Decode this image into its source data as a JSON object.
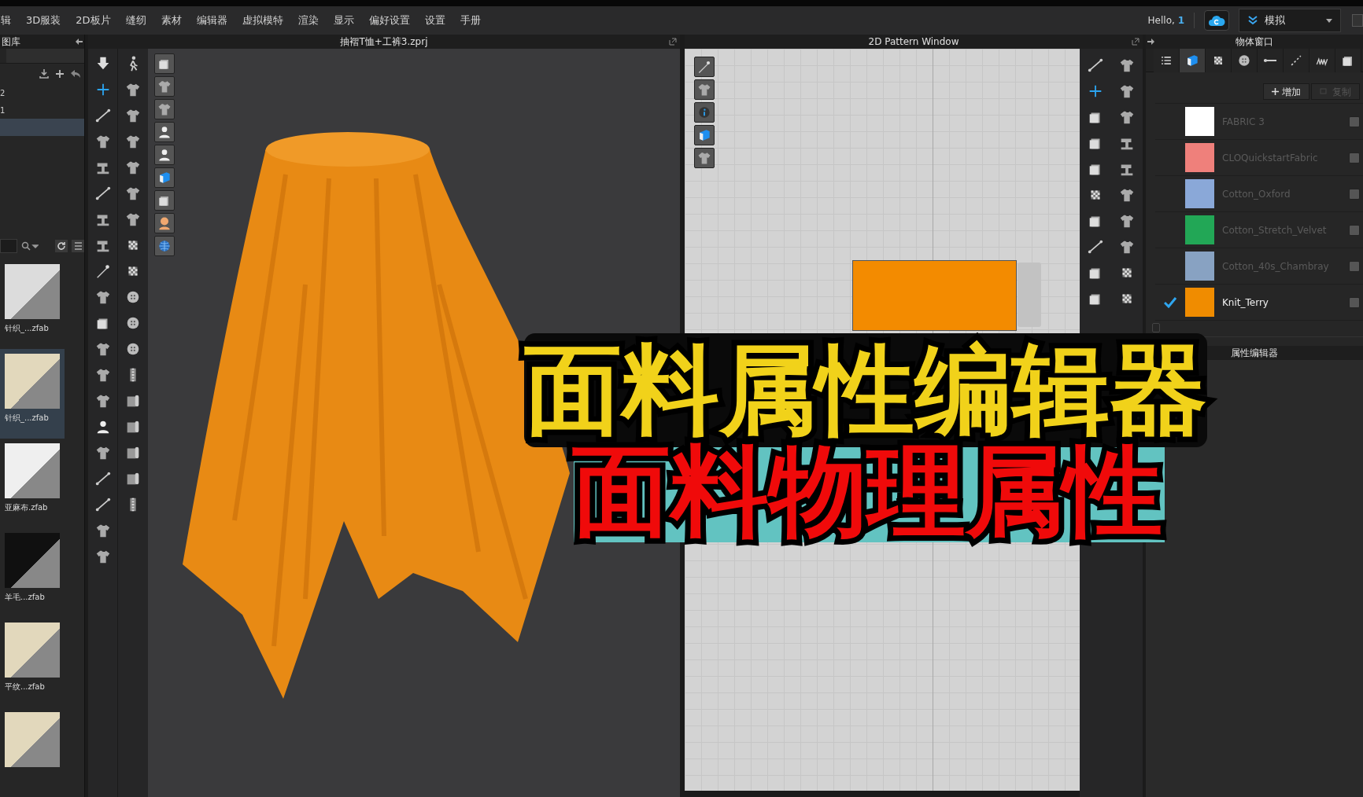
{
  "menu": [
    "辑",
    "3D服装",
    "2D板片",
    "缝纫",
    "素材",
    "编辑器",
    "虚拟模特",
    "渲染",
    "显示",
    "偏好设置",
    "设置",
    "手册"
  ],
  "user": {
    "greeting": "Hello,",
    "name": "1"
  },
  "mode": {
    "label": "模拟"
  },
  "library": {
    "title": "图库",
    "rows": [
      {
        "label": "2",
        "selected": false
      },
      {
        "label": "1",
        "selected": false
      },
      {
        "selected": true
      }
    ],
    "thumbnails": [
      {
        "label": "针织_...zfab",
        "color": "#dcdcdc",
        "selected": false
      },
      {
        "label": "针织_...zfab",
        "color": "#e2d8bc",
        "selected": true
      },
      {
        "label": "亚麻布.zfab",
        "color": "#efefef",
        "selected": false
      },
      {
        "label": "羊毛...zfab",
        "color": "#101010",
        "selected": false
      },
      {
        "label": "平纹...zfab",
        "color": "#e2d8bc",
        "selected": false
      },
      {
        "color": "#e2d8bc",
        "selected": false
      }
    ]
  },
  "viewport_3d": {
    "title": "抽褶T恤+工裤3.zprj"
  },
  "pattern_window": {
    "title": "2D Pattern Window"
  },
  "object_browser": {
    "title": "物体窗口",
    "tabs": [
      {
        "selected": false
      },
      {
        "selected": true
      },
      {
        "selected": false
      },
      {
        "selected": false
      },
      {
        "selected": false
      },
      {
        "selected": false
      },
      {
        "selected": false
      },
      {
        "selected": false
      }
    ],
    "add_button": "增加",
    "copy_button": {
      "label": "复制",
      "disabled": true
    },
    "fabrics": [
      {
        "name": "FABRIC 3",
        "color": "#ffffff",
        "checked": false
      },
      {
        "name": "CLOQuickstartFabric",
        "color": "#ef807b",
        "checked": false
      },
      {
        "name": "Cotton_Oxford",
        "color": "#8aa8d8",
        "checked": false
      },
      {
        "name": "Cotton_Stretch_Velvet",
        "color": "#22a756",
        "checked": false
      },
      {
        "name": "Cotton_40s_Chambray",
        "color": "#88a2c2",
        "checked": false
      },
      {
        "name": "Knit_Terry",
        "color": "#f08c00",
        "checked": true
      }
    ]
  },
  "property_editor": {
    "title": "属性编辑器"
  },
  "overlay": {
    "title": "面料属性编辑器",
    "subtitle": "面料物理属性"
  }
}
